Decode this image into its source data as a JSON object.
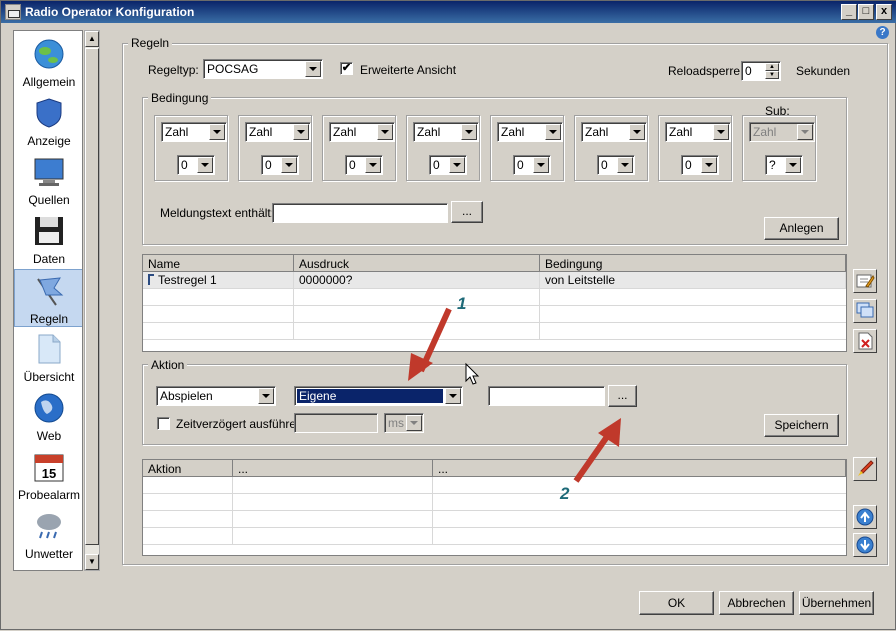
{
  "window": {
    "title": "Radio Operator Konfiguration",
    "min": "_",
    "max": "□",
    "close": "x",
    "help": "?"
  },
  "sidebar": {
    "items": [
      {
        "label": "Allgemein",
        "icon": "globe-icon"
      },
      {
        "label": "Anzeige",
        "icon": "shield-icon"
      },
      {
        "label": "Quellen",
        "icon": "monitor-icon"
      },
      {
        "label": "Daten",
        "icon": "floppy-disk-icon"
      },
      {
        "label": "Regeln",
        "icon": "flag-icon",
        "selected": true
      },
      {
        "label": "Übersicht",
        "icon": "document-icon"
      },
      {
        "label": "Web",
        "icon": "web-globe-icon"
      },
      {
        "label": "Probealarm",
        "icon": "calendar-icon"
      },
      {
        "label": "Unwetter",
        "icon": "storm-cloud-icon"
      }
    ]
  },
  "regeln": {
    "group_label": "Regeln",
    "regeltyp_label": "Regeltyp:",
    "regeltyp_value": "POCSAG",
    "erweiterte_label": "Erweiterte Ansicht",
    "erweiterte_checked": "✔",
    "reload_label": "Reloadsperre:",
    "reload_value": "0",
    "sekunden_label": "Sekunden"
  },
  "bedingung": {
    "group_label": "Bedingung",
    "sub_label": "Sub:",
    "boxes": [
      {
        "type": "Zahl",
        "val": "0"
      },
      {
        "type": "Zahl",
        "val": "0"
      },
      {
        "type": "Zahl",
        "val": "0"
      },
      {
        "type": "Zahl",
        "val": "0"
      },
      {
        "type": "Zahl",
        "val": "0"
      },
      {
        "type": "Zahl",
        "val": "0"
      },
      {
        "type": "Zahl",
        "val": "0"
      },
      {
        "type": "Zahl",
        "val": "?"
      }
    ],
    "meldung_label": "Meldungstext enthält:",
    "meldung_value": "",
    "browse_label": "...",
    "anlegen_label": "Anlegen"
  },
  "rules_table": {
    "columns": [
      "Name",
      "Ausdruck",
      "Bedingung"
    ],
    "rows": [
      {
        "name": "Testregel 1",
        "ausdruck": "0000000?",
        "bedingung": "von Leitstelle"
      }
    ]
  },
  "aktion": {
    "group_label": "Aktion",
    "action_value": "Abspielen",
    "sound_value": "Eigene",
    "path_value": "",
    "browse_label": "...",
    "delay_label": "Zeitverzögert ausführen",
    "delay_value": "",
    "unit_value": "ms",
    "save_label": "Speichern"
  },
  "action_table": {
    "columns": [
      "Aktion",
      "...",
      "..."
    ]
  },
  "annotations": {
    "one": "1",
    "two": "2"
  },
  "footer": {
    "ok": "OK",
    "cancel": "Abbrechen",
    "apply": "Übernehmen"
  },
  "colors": {
    "titlebar": "#0a246a",
    "arrow": "#c0392b",
    "annotation": "#1e6a78"
  }
}
